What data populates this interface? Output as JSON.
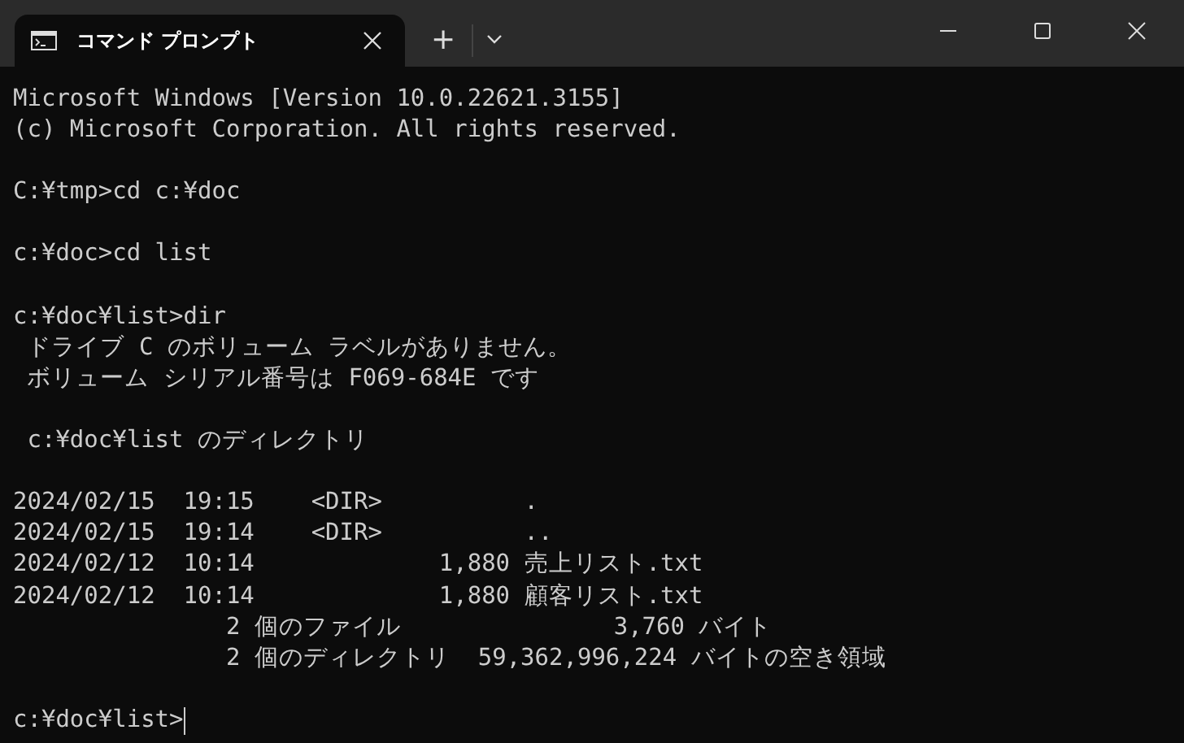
{
  "window": {
    "tabs": [
      {
        "title": "コマンド プロンプト",
        "selected": true
      }
    ],
    "new_tab": "+"
  },
  "terminal": {
    "blocks": [
      [
        "Microsoft Windows [Version 10.0.22621.3155]",
        "(c) Microsoft Corporation. All rights reserved."
      ],
      [
        "C:¥tmp>cd c:¥doc"
      ],
      [
        "c:¥doc>cd list"
      ],
      [
        "c:¥doc¥list>dir",
        " ドライブ C のボリューム ラベルがありません。",
        " ボリューム シリアル番号は F069-684E です"
      ],
      [
        " c:¥doc¥list のディレクトリ"
      ],
      [
        "2024/02/15  19:15    <DIR>          .",
        "2024/02/15  19:14    <DIR>          ..",
        "2024/02/12  10:14             1,880 売上リスト.txt",
        "2024/02/12  10:14             1,880 顧客リスト.txt",
        "               2 個のファイル               3,760 バイト",
        "               2 個のディレクトリ  59,362,996,224 バイトの空き領域"
      ]
    ],
    "prompt": "c:¥doc¥list>",
    "cursor": true
  }
}
